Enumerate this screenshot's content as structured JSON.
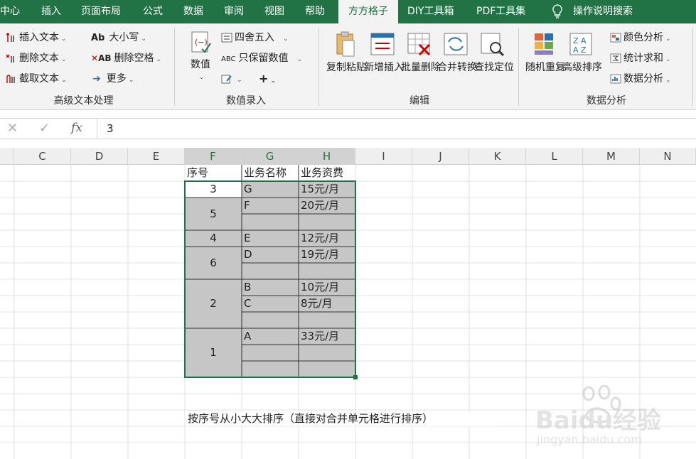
{
  "tabs": [
    "中心",
    "插入",
    "页面布局",
    "公式",
    "数据",
    "审阅",
    "视图",
    "帮助",
    "方方格子",
    "DIY工具箱",
    "PDF工具集",
    "操作说明搜索"
  ],
  "ribbon": {
    "text_group": {
      "items": [
        "插入文本",
        "删除文本",
        "截取文本",
        "大小写",
        "删除空格",
        "更多"
      ],
      "label": "高级文本处理"
    },
    "value_group": {
      "big": "数值",
      "items": [
        "四舍五入",
        "只保留数值"
      ],
      "label": "数值录入"
    },
    "edit_group": {
      "items": [
        "复制粘贴",
        "新增插入",
        "批量删除",
        "合并转换",
        "查找定位"
      ],
      "label": "编辑"
    },
    "analysis_group": {
      "items": [
        "随机重复",
        "高级排序",
        "颜色分析",
        "统计求和",
        "数据分析"
      ],
      "label": "数据分析"
    }
  },
  "formula": {
    "value": "3"
  },
  "columns": [
    "C",
    "D",
    "E",
    "F",
    "G",
    "H",
    "I",
    "J",
    "K",
    "L",
    "M",
    "N"
  ],
  "table": {
    "headers": [
      "序号",
      "业务名称",
      "业务资费"
    ],
    "seq": [
      "3",
      "5",
      "4",
      "6",
      "2",
      "1"
    ],
    "names": [
      "G",
      "F",
      "E",
      "D",
      "B",
      "C",
      "A"
    ],
    "fees": [
      "15元/月",
      "20元/月",
      "12元/月",
      "19元/月",
      "10元/月",
      "8元/月",
      "33元/月"
    ]
  },
  "note": "按序号从小大大排序（直接对合并单元格进行排序）",
  "watermark": {
    "brand": "Baidu经验",
    "url": "jingyan.baidu.com"
  },
  "colors": {
    "accent": "#217346",
    "selection": "#c6c6c6"
  }
}
